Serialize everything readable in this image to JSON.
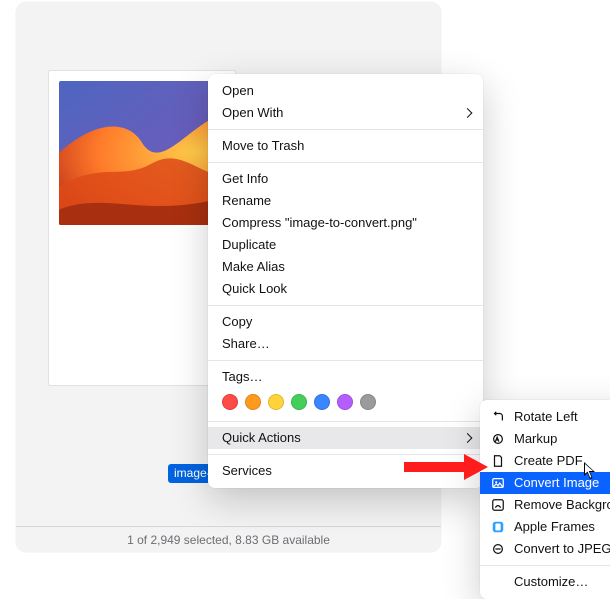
{
  "file": {
    "visible_name": "image-to"
  },
  "status": {
    "text": "1 of 2,949 selected, 8.83 GB available"
  },
  "context_menu": {
    "open": "Open",
    "open_with": "Open With",
    "move_to_trash": "Move to Trash",
    "get_info": "Get Info",
    "rename": "Rename",
    "compress": "Compress \"image-to-convert.png\"",
    "duplicate": "Duplicate",
    "make_alias": "Make Alias",
    "quick_look": "Quick Look",
    "copy": "Copy",
    "share": "Share…",
    "tags_label": "Tags…",
    "tag_colors": [
      "#ff4b46",
      "#ff9a1f",
      "#ffd43a",
      "#44cf5b",
      "#3a86ff",
      "#b55dff",
      "#9b9b9e"
    ],
    "quick_actions": "Quick Actions",
    "services": "Services"
  },
  "sub_menu": {
    "rotate_left": "Rotate Left",
    "markup": "Markup",
    "create_pdf": "Create PDF",
    "convert_image": "Convert Image",
    "remove_background": "Remove Background",
    "apple_frames": "Apple Frames",
    "convert_to_jpeg": "Convert to JPEG",
    "customize": "Customize…"
  }
}
